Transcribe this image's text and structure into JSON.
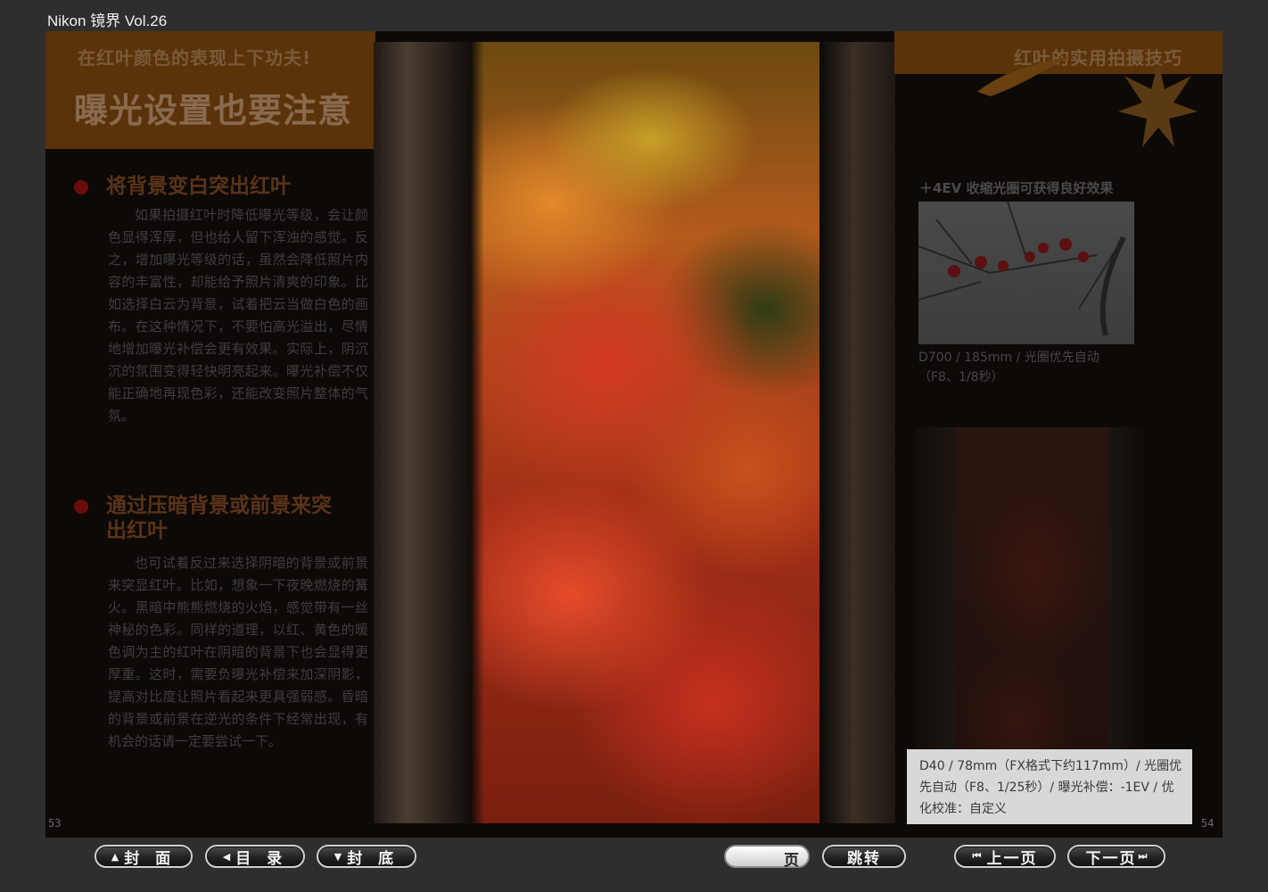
{
  "window": {
    "title": "Nikon 镜界 Vol.26"
  },
  "left_page": {
    "subtitle": "在红叶颜色的表现上下功夫!",
    "title": "曝光设置也要注意",
    "sections": [
      {
        "heading": "将背景变白突出红叶",
        "body": "如果拍摄红叶时降低曝光等级，会让颜色显得浑厚，但也给人留下浑浊的感觉。反之，增加曝光等级的话，虽然会降低照片内容的丰富性，却能给予照片清爽的印象。比如选择白云为背景，试着把云当做白色的画布。在这种情况下，不要怕高光溢出，尽情地增加曝光补偿会更有效果。实际上，阴沉沉的氛围变得轻快明亮起来。曝光补偿不仅能正确地再现色彩，还能改变照片整体的气氛。"
      },
      {
        "heading": "通过压暗背景或前景来突出红叶",
        "body": "也可试着反过来选择阴暗的背景或前景来突显红叶。比如，想象一下夜晚燃烧的篝火。黑暗中熊熊燃烧的火焰，感觉带有一丝神秘的色彩。同样的道理，以红、黄色的暖色调为主的红叶在阴暗的背景下也会显得更厚重。这时，需要负曝光补偿来加深阴影，提高对比度让照片看起来更具强弱感。昏暗的背景或前景在逆光的条件下经常出现，有机会的话请一定要尝试一下。"
      }
    ],
    "page_number": "53"
  },
  "right_page": {
    "title": "红叶的实用拍摄技巧",
    "photo1_caption_title": "＋4EV 收缩光圈可获得良好效果",
    "photo1_caption_line1": "D700 / 185mm / 光圈优先自动",
    "photo1_caption_line2": "（F8、1/8秒）",
    "main_caption": "D40 / 78mm（FX格式下约117mm）/ 光圈优先自动（F8、1/25秒）/ 曝光补偿：-1EV / 优化校准：自定义",
    "page_number": "54"
  },
  "toolbar": {
    "cover_label": "封 面",
    "toc_label": "目 录",
    "back_cover_label": "封 底",
    "page_input_value": "",
    "page_label": "页",
    "jump_label": "跳转",
    "prev_label": "上一页",
    "next_label": "下一页"
  },
  "icons": {
    "cover": "triangle-up-icon",
    "toc": "triangle-left-icon",
    "back_cover": "triangle-down-icon",
    "prev": "skip-back-icon",
    "next": "skip-forward-icon"
  },
  "colors": {
    "background": "#2e2e2e",
    "page_dark": "#0d0907",
    "band_orange": "#5a330a",
    "caption_box": "#d8d8d8"
  }
}
